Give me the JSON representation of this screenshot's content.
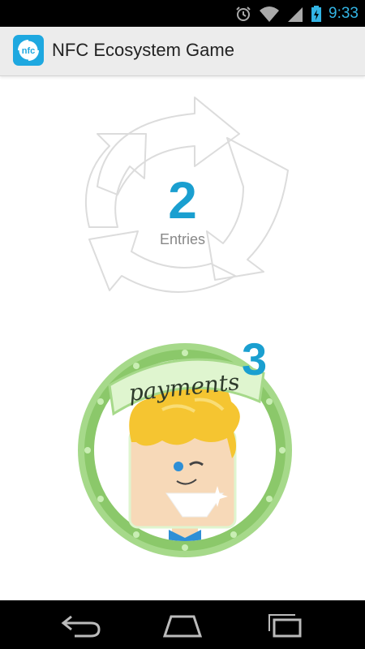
{
  "status_bar": {
    "time": "9:33",
    "icons": [
      "alarm-icon",
      "wifi-icon",
      "signal-icon",
      "battery-charging-icon"
    ]
  },
  "action_bar": {
    "app_icon": "nfc-logo-icon",
    "app_icon_text": "nfc",
    "title": "NFC Ecosystem Game"
  },
  "counter": {
    "value": "2",
    "label": "Entries"
  },
  "badge": {
    "name": "payments",
    "count": "3"
  },
  "nav_bar": {
    "buttons": [
      "back-icon",
      "home-icon",
      "recent-apps-icon"
    ]
  },
  "colors": {
    "accent": "#1a9fd0",
    "status_accent": "#33b5e5",
    "badge_green": "#8bc86a"
  }
}
